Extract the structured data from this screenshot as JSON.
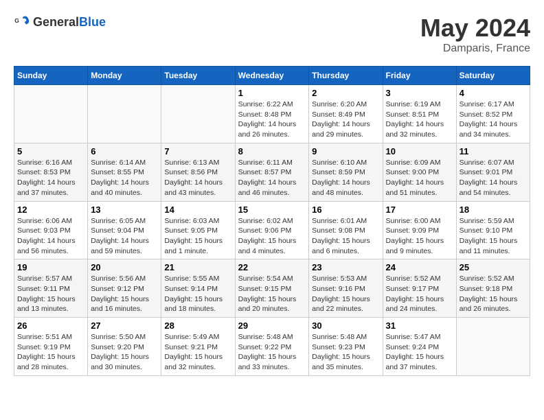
{
  "header": {
    "logo_general": "General",
    "logo_blue": "Blue",
    "title": "May 2024",
    "subtitle": "Damparis, France"
  },
  "days_of_week": [
    "Sunday",
    "Monday",
    "Tuesday",
    "Wednesday",
    "Thursday",
    "Friday",
    "Saturday"
  ],
  "weeks": [
    [
      {
        "day": "",
        "content": ""
      },
      {
        "day": "",
        "content": ""
      },
      {
        "day": "",
        "content": ""
      },
      {
        "day": "1",
        "content": "Sunrise: 6:22 AM\nSunset: 8:48 PM\nDaylight: 14 hours and 26 minutes."
      },
      {
        "day": "2",
        "content": "Sunrise: 6:20 AM\nSunset: 8:49 PM\nDaylight: 14 hours and 29 minutes."
      },
      {
        "day": "3",
        "content": "Sunrise: 6:19 AM\nSunset: 8:51 PM\nDaylight: 14 hours and 32 minutes."
      },
      {
        "day": "4",
        "content": "Sunrise: 6:17 AM\nSunset: 8:52 PM\nDaylight: 14 hours and 34 minutes."
      }
    ],
    [
      {
        "day": "5",
        "content": "Sunrise: 6:16 AM\nSunset: 8:53 PM\nDaylight: 14 hours and 37 minutes."
      },
      {
        "day": "6",
        "content": "Sunrise: 6:14 AM\nSunset: 8:55 PM\nDaylight: 14 hours and 40 minutes."
      },
      {
        "day": "7",
        "content": "Sunrise: 6:13 AM\nSunset: 8:56 PM\nDaylight: 14 hours and 43 minutes."
      },
      {
        "day": "8",
        "content": "Sunrise: 6:11 AM\nSunset: 8:57 PM\nDaylight: 14 hours and 46 minutes."
      },
      {
        "day": "9",
        "content": "Sunrise: 6:10 AM\nSunset: 8:59 PM\nDaylight: 14 hours and 48 minutes."
      },
      {
        "day": "10",
        "content": "Sunrise: 6:09 AM\nSunset: 9:00 PM\nDaylight: 14 hours and 51 minutes."
      },
      {
        "day": "11",
        "content": "Sunrise: 6:07 AM\nSunset: 9:01 PM\nDaylight: 14 hours and 54 minutes."
      }
    ],
    [
      {
        "day": "12",
        "content": "Sunrise: 6:06 AM\nSunset: 9:03 PM\nDaylight: 14 hours and 56 minutes."
      },
      {
        "day": "13",
        "content": "Sunrise: 6:05 AM\nSunset: 9:04 PM\nDaylight: 14 hours and 59 minutes."
      },
      {
        "day": "14",
        "content": "Sunrise: 6:03 AM\nSunset: 9:05 PM\nDaylight: 15 hours and 1 minute."
      },
      {
        "day": "15",
        "content": "Sunrise: 6:02 AM\nSunset: 9:06 PM\nDaylight: 15 hours and 4 minutes."
      },
      {
        "day": "16",
        "content": "Sunrise: 6:01 AM\nSunset: 9:08 PM\nDaylight: 15 hours and 6 minutes."
      },
      {
        "day": "17",
        "content": "Sunrise: 6:00 AM\nSunset: 9:09 PM\nDaylight: 15 hours and 9 minutes."
      },
      {
        "day": "18",
        "content": "Sunrise: 5:59 AM\nSunset: 9:10 PM\nDaylight: 15 hours and 11 minutes."
      }
    ],
    [
      {
        "day": "19",
        "content": "Sunrise: 5:57 AM\nSunset: 9:11 PM\nDaylight: 15 hours and 13 minutes."
      },
      {
        "day": "20",
        "content": "Sunrise: 5:56 AM\nSunset: 9:12 PM\nDaylight: 15 hours and 16 minutes."
      },
      {
        "day": "21",
        "content": "Sunrise: 5:55 AM\nSunset: 9:14 PM\nDaylight: 15 hours and 18 minutes."
      },
      {
        "day": "22",
        "content": "Sunrise: 5:54 AM\nSunset: 9:15 PM\nDaylight: 15 hours and 20 minutes."
      },
      {
        "day": "23",
        "content": "Sunrise: 5:53 AM\nSunset: 9:16 PM\nDaylight: 15 hours and 22 minutes."
      },
      {
        "day": "24",
        "content": "Sunrise: 5:52 AM\nSunset: 9:17 PM\nDaylight: 15 hours and 24 minutes."
      },
      {
        "day": "25",
        "content": "Sunrise: 5:52 AM\nSunset: 9:18 PM\nDaylight: 15 hours and 26 minutes."
      }
    ],
    [
      {
        "day": "26",
        "content": "Sunrise: 5:51 AM\nSunset: 9:19 PM\nDaylight: 15 hours and 28 minutes."
      },
      {
        "day": "27",
        "content": "Sunrise: 5:50 AM\nSunset: 9:20 PM\nDaylight: 15 hours and 30 minutes."
      },
      {
        "day": "28",
        "content": "Sunrise: 5:49 AM\nSunset: 9:21 PM\nDaylight: 15 hours and 32 minutes."
      },
      {
        "day": "29",
        "content": "Sunrise: 5:48 AM\nSunset: 9:22 PM\nDaylight: 15 hours and 33 minutes."
      },
      {
        "day": "30",
        "content": "Sunrise: 5:48 AM\nSunset: 9:23 PM\nDaylight: 15 hours and 35 minutes."
      },
      {
        "day": "31",
        "content": "Sunrise: 5:47 AM\nSunset: 9:24 PM\nDaylight: 15 hours and 37 minutes."
      },
      {
        "day": "",
        "content": ""
      }
    ]
  ]
}
